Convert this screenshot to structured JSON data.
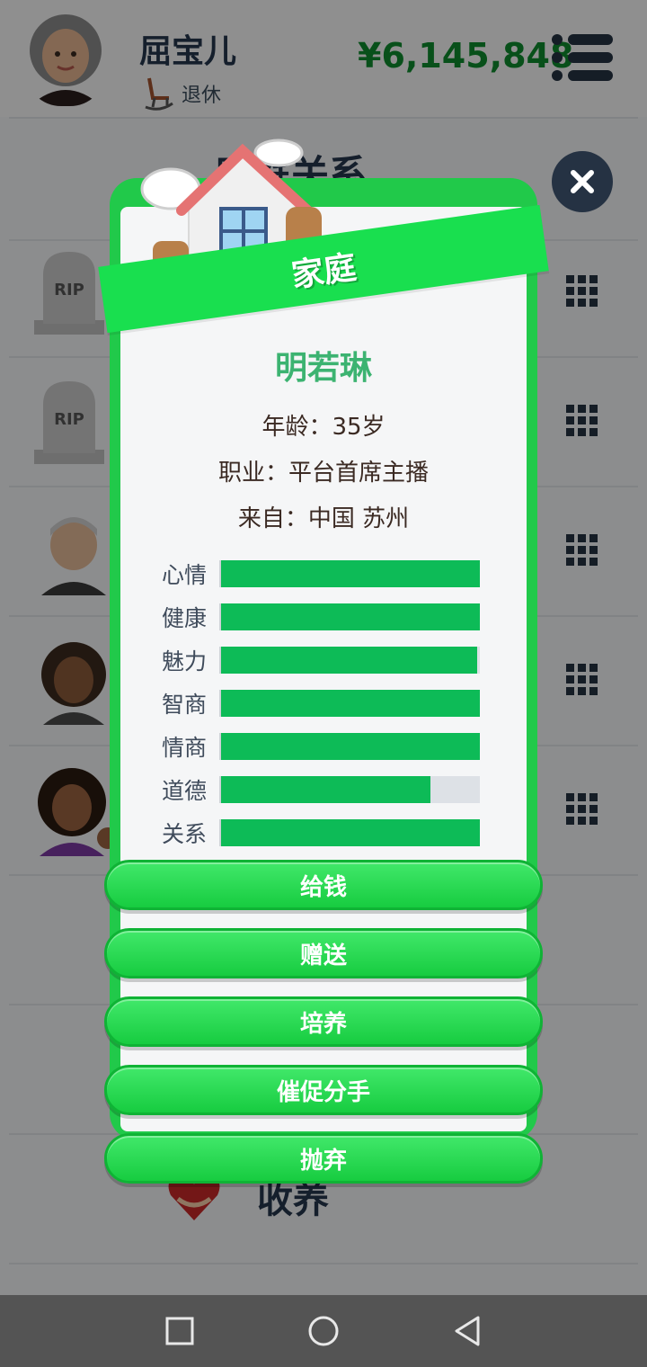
{
  "player": {
    "name": "屈宝儿",
    "status": "退休",
    "money": "¥6,145,848"
  },
  "section": {
    "title": "家庭关系",
    "adopt_label": "收养"
  },
  "modal": {
    "ribbon": "家庭",
    "person_name": "明若琳",
    "age_line": "年龄：35岁",
    "job_line": "职业：平台首席主播",
    "from_line": "来自：中国 苏州",
    "stats": [
      {
        "label": "心情",
        "value": 1.0
      },
      {
        "label": "健康",
        "value": 1.0
      },
      {
        "label": "魅力",
        "value": 0.99
      },
      {
        "label": "智商",
        "value": 1.0
      },
      {
        "label": "情商",
        "value": 1.0
      },
      {
        "label": "道德",
        "value": 0.81
      },
      {
        "label": "关系",
        "value": 1.0
      }
    ],
    "actions": [
      "给钱",
      "赠送",
      "培养",
      "催促分手",
      "抛弃"
    ]
  },
  "icons": {
    "tomb_text": "RIP",
    "menu": "hamburger-icon",
    "close": "close-icon",
    "grid": "grid-icon",
    "nav": [
      "square-icon",
      "circle-icon",
      "back-triangle-icon"
    ]
  },
  "colors": {
    "money": "#0f8a2e",
    "card_green": "#21c94a",
    "bar_fill": "#0dbb57",
    "name_green": "#3cb371"
  }
}
